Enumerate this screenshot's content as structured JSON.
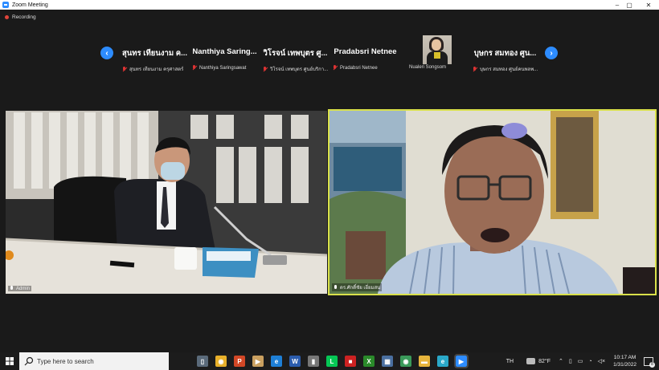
{
  "window": {
    "title": "Zoom Meeting",
    "controls": [
      "–",
      "▢",
      "✕"
    ]
  },
  "recording": {
    "label": "Recording"
  },
  "gallery": {
    "participants": [
      {
        "big_name": "สุนทร เทียนงาม ค...",
        "caption": "สุนทร เทียนงาม ครุศาสตร์",
        "muted": true
      },
      {
        "big_name": "Nanthiya  Saring...",
        "caption": "Nanthiya Saringsawat",
        "muted": true
      },
      {
        "big_name": "วิโรจน์ เทพบุตร ศู...",
        "caption": "วิโรจน์ เทพบุตร ศูนย์บริกา...",
        "muted": true
      },
      {
        "big_name": "Pradabsri Netnee",
        "caption": "Pradabsri Netnee",
        "muted": true
      },
      {
        "big_name": "",
        "caption": "Nualeri Songsom",
        "muted": false,
        "has_video": true
      },
      {
        "big_name": "บุษกร สมทอง ศูน...",
        "caption": "บุษกร สมทอง ศูนย์คนพลพ...",
        "muted": true
      }
    ],
    "prev_icon": "‹",
    "next_icon": "›"
  },
  "videos": {
    "left": {
      "caption": "Admin"
    },
    "right": {
      "caption": "ดร.ศักดิ์ชัย เอี่ยมสน",
      "active_speaker": true,
      "highlight_color": "#d9e04a"
    }
  },
  "taskbar": {
    "search_placeholder": "Type here to search",
    "apps": [
      {
        "name": "phone-app-icon",
        "glyph": "▯",
        "color": "#5a6a7a"
      },
      {
        "name": "chrome-icon",
        "glyph": "◉",
        "color": "#e8b02a"
      },
      {
        "name": "powerpoint-icon",
        "glyph": "P",
        "color": "#d24726"
      },
      {
        "name": "video-app-icon",
        "glyph": "▶",
        "color": "#caa060"
      },
      {
        "name": "edge-icon",
        "glyph": "e",
        "color": "#1e7fd6"
      },
      {
        "name": "word-icon",
        "glyph": "W",
        "color": "#2b5cad"
      },
      {
        "name": "usb-icon",
        "glyph": "▮",
        "color": "#777"
      },
      {
        "name": "line-icon",
        "glyph": "L",
        "color": "#06c755"
      },
      {
        "name": "red-app-icon",
        "glyph": "■",
        "color": "#c22"
      },
      {
        "name": "xbox-icon",
        "glyph": "X",
        "color": "#2a8a2a"
      },
      {
        "name": "calculator-icon",
        "glyph": "▦",
        "color": "#4a6fa0"
      },
      {
        "name": "chrome-user-icon",
        "glyph": "◉",
        "color": "#3a9a5a"
      },
      {
        "name": "file-explorer-icon",
        "glyph": "▬",
        "color": "#e6b43c"
      },
      {
        "name": "edge-new-icon",
        "glyph": "e",
        "color": "#2aa8c8"
      },
      {
        "name": "zoom-icon",
        "glyph": "▶",
        "color": "#2d8cff"
      }
    ],
    "tray": {
      "lang": "TH",
      "temperature": "82°F",
      "time": "10:17 AM",
      "date": "1/31/2022",
      "notification_count": "8"
    }
  }
}
